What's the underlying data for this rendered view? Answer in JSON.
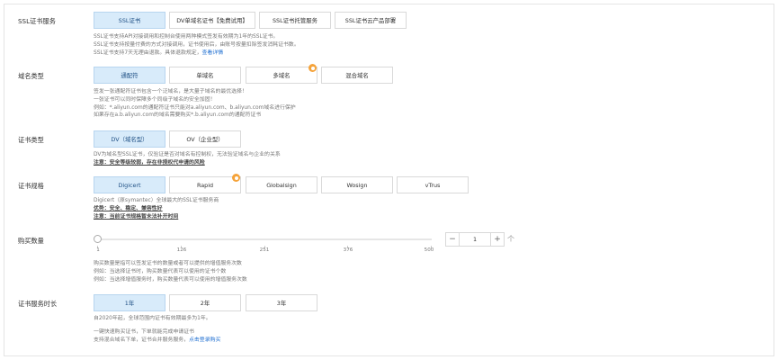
{
  "cert_service": {
    "label": "SSL证书服务",
    "options": [
      "SSL证书",
      "DV单域名证书【免费试用】",
      "SSL证书托管服务",
      "SSL证书云产品部署"
    ],
    "desc": [
      "SSL证书支持API对接调用和控制台使用两种模式签发有效期为1年的SSL证书。",
      "SSL证书支持按量付费的方式对接调用，证书使用后，由账号按量扣除签发消耗证书数。",
      "SSL证书支持7天无理由退款。具体退款规定。"
    ],
    "desc_tail_prefix": "SSL证书支持7天无理由退款。具体退款规定，",
    "desc_link": "查看详情"
  },
  "domain_type": {
    "label": "域名类型",
    "options": [
      "通配符",
      "单域名",
      "多域名",
      "混合域名"
    ],
    "desc": [
      "签发一张通配符证书包含一个泛域名，是大量子域名的最优选择！",
      "一张证书可以同时保障多个同级子域名的安全加固！",
      "例如：*.aliyun.com的通配符证书只能对a.aliyun.com、b.aliyun.com域名进行保护",
      "如果存在a.b.aliyun.com的域名需要购买*.b.aliyun.com的通配符证书"
    ]
  },
  "cert_type": {
    "label": "证书类型",
    "options": [
      "DV（域名型）",
      "OV（企业型）"
    ],
    "desc": "DV为域名型SSL证书，仅验证是否对域名有控制权，无法验证域名与企业的关系",
    "note": "注意：安全等级较弱，存在非授权代申请的风险"
  },
  "cert_spec": {
    "label": "证书规格",
    "options": [
      "Digicert",
      "Rapid",
      "Globalsign",
      "Wosign",
      "vTrus"
    ],
    "desc": "Digicert（原symantec）全球最大的SSL证书服务商",
    "advantage": "优势：安全、稳定、兼容性好",
    "note": "注意：当前证书规格暂未法补开时间"
  },
  "quantity": {
    "label": "购买数量",
    "ticks": [
      "1",
      "126",
      "251",
      "376",
      "500"
    ],
    "value": "1",
    "minus": "−",
    "plus": "+",
    "unit": "个",
    "desc": [
      "购买数量是指可以签发证书的数量或者可以提供的增值服务次数",
      "例如：当选择证书时，购买数量代表可以使用的证书个数",
      "例如：当选择增值服务时，购买数量代表可以使用的增值服务次数"
    ]
  },
  "duration": {
    "label": "证书服务时长",
    "options": [
      "1年",
      "2年",
      "3年"
    ],
    "desc": "自2020年起，全球范围内证书有效期最多为1年。",
    "extra": [
      "一键快速购买证书，下单就能完成申请证书",
      "支持混合域名下单，证书合并服务服务，"
    ],
    "extra_link": "点击登录购买"
  }
}
